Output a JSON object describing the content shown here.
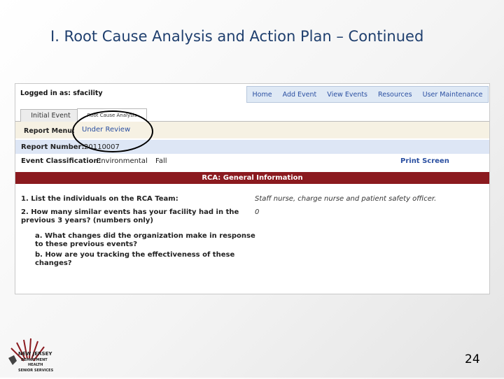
{
  "slide": {
    "title": "I.  Root Cause Analysis and Action Plan – Continued",
    "page_number": "24"
  },
  "app": {
    "logged_in": "Logged in as: sfacility",
    "nav": [
      "Home",
      "Add Event",
      "View Events",
      "Resources",
      "User Maintenance"
    ],
    "tabs": [
      "Initial Event",
      "Root Cause Analysis"
    ],
    "report_menu_label": "Report Menu:",
    "report_menu_link": "Under Review",
    "report_number_label": "Report Number:",
    "report_number": "20110007",
    "event_class_label": "Event Classification:",
    "event_class_value": "Environmental",
    "event_class_value2": "Fall",
    "print_link": "Print Screen",
    "section_banner": "RCA: General Information",
    "q1": "1. List the individuals on the RCA Team:",
    "a1": "Staff nurse, charge nurse and patient safety officer.",
    "q2_line1": "2. How many similar events has your facility had in the",
    "q2_line2": "previous 3 years? (numbers only)",
    "a2": "0",
    "qa_line1": "a. What changes did the organization make in response",
    "qa_line2": "to these previous events?",
    "qb_line1": "b. How are you tracking the effectiveness of these",
    "qb_line2": "changes?"
  },
  "logo": {
    "line1": "NEW JERSEY",
    "line2": "DEPARTMENT",
    "line3": "HEALTH",
    "line4": "SENIOR SERVICES",
    "color": "#8b1a1f"
  }
}
